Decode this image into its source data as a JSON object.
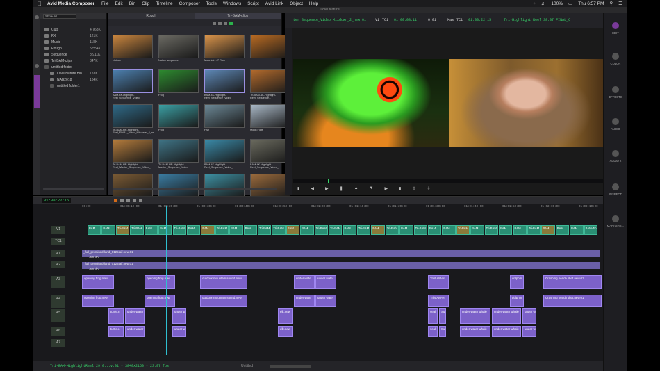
{
  "menubar": {
    "app": "Avid Media Composer",
    "items": [
      "File",
      "Edit",
      "Bin",
      "Clip",
      "Timeline",
      "Composer",
      "Tools",
      "Windows",
      "Script",
      "Avid Link",
      "Object",
      "Help"
    ],
    "battery": "100%",
    "clock": "Thu 6:57 PM"
  },
  "window_title": "Love Nature",
  "bin": {
    "filter": "Show All",
    "items": [
      {
        "name": "Cuts",
        "size": "4,768K"
      },
      {
        "name": "FX",
        "size": "121K"
      },
      {
        "name": "Music",
        "size": "118K"
      },
      {
        "name": "Rough",
        "size": "5,554K"
      },
      {
        "name": "Sequence",
        "size": "8,911K"
      },
      {
        "name": "Tri-BAM-clips",
        "size": "347K"
      },
      {
        "name": "untitled folder",
        "size": ""
      },
      {
        "name": "Love Nature Bin",
        "size": "178K"
      },
      {
        "name": "NAB2018",
        "size": "164K"
      },
      {
        "name": "untitled folder1",
        "size": ""
      }
    ]
  },
  "thumb_bin": {
    "tabs": [
      "Rough",
      "Tri-BAM-clips"
    ],
    "thumbs": [
      {
        "caption": "Nutrole",
        "color": "#c9853e"
      },
      {
        "caption": "Nature sequence",
        "color": "#6b6a63"
      },
      {
        "caption": "Mountain - 7 Rum",
        "color": "#d8934a"
      },
      {
        "caption": "",
        "color": "#b86a22"
      },
      {
        "caption": "BAM-4K-Highlight-Reel_Sequence_Video_",
        "color": "#4c7fae"
      },
      {
        "caption": "Frog",
        "color": "#2d8a2f"
      },
      {
        "caption": "BAM-4K-Highlight-Reel_Sequence_Video_",
        "color": "#5d87b5"
      },
      {
        "caption": "Tri-BAM-4K-Highlight-Reel_Sequence...",
        "color": "#b26a2c"
      },
      {
        "caption": "Tri-BAM-HR-Highlight-Reel_FINAL_Video_Mixdown_4_new.01",
        "color": "#2f6a88"
      },
      {
        "caption": "Frog",
        "color": "#3ba0a4"
      },
      {
        "caption": "Fish",
        "color": "#6c8896"
      },
      {
        "caption": "Moon Flats",
        "color": "#a9b8c6"
      },
      {
        "caption": "Tri-BAM-HR-Highlight-Reel_Master_Sequence_Video_",
        "color": "#b57c3c"
      },
      {
        "caption": "Tri-BAM-HR-Highlight-Master_Sequence_Video",
        "color": "#3f7486"
      },
      {
        "caption": "BAM-4K-Highlight-Reel_Sequence_Video_",
        "color": "#3a8aa8"
      },
      {
        "caption": "BAM-4K-Highlight-Reel_Sequence_Video_",
        "color": "#6a6a5e"
      },
      {
        "caption": "",
        "color": "#7a5a34"
      },
      {
        "caption": "BAM-HR-Highlight-Video",
        "color": "#3a7ba0"
      },
      {
        "caption": "Tri-BAM-Highlight-Reel_FINAL_Video_Mixdown",
        "color": "#3d8fa1"
      },
      {
        "caption": "BAM-HR-Highlight-Video",
        "color": "#9a6a3c"
      }
    ]
  },
  "monitor": {
    "source_name": "ter Sequence_Video Mixdown_2_new.01",
    "track": "V1",
    "tc1": "TC1",
    "tc_source": "01:00:03:11",
    "dur": "0:01",
    "mas": "Mas",
    "tc_mas": "01:00:22:15",
    "record_name": "Tri-Highlight Reel 38.07 FINAL_Copy.01"
  },
  "palette": [
    {
      "label": "EDIT"
    },
    {
      "label": "COLOR"
    },
    {
      "label": "EFFECTS"
    },
    {
      "label": "AUDIO"
    },
    {
      "label": "AUDIO 2"
    },
    {
      "label": "INSPECT"
    },
    {
      "label": "MARKERS..."
    }
  ],
  "timeline": {
    "timecode": "01:00:22:15",
    "ruler": [
      "00:00",
      "01:00:10:00",
      "01:00:20:00",
      "01:00:30:00",
      "01:00:40:00",
      "01:00:50:00",
      "01:01:00:00",
      "01:01:10:00",
      "01:01:20:00",
      "01:01:30:00",
      "01:01:40:00",
      "01:01:50:00",
      "01:02:00:00",
      "01:02:10:00"
    ],
    "tracks": [
      "V1",
      "TC1",
      "A1",
      "A2",
      "A3",
      "A4",
      "A5",
      "A6",
      "A7"
    ],
    "a1_clip": "_full_promised-land_0125.aif.new.01",
    "a1_level": "-6.5 db",
    "a2_clip": "_full_promised-land_0125.aif.new.01",
    "a2_level": "-6.5 db",
    "a3_clips": [
      "opening frog.new",
      "opening frog.new",
      "outdoor mountain sound.new",
      "under wate",
      "under wate",
      "Tri-BAM-H",
      "dolphin",
      "Crashing beach shot.new.01"
    ],
    "a5_clips": [
      "turtle.n",
      "under water",
      "under water",
      "elk.new",
      "seal",
      "Su",
      "under water whale",
      "under water whale",
      "under water whale"
    ],
    "v1_clips": [
      "BAM",
      "BAM",
      "Tri-BAM",
      "Tri-BAM",
      "BAM",
      "BAM",
      "Tri-BAM",
      "BAM",
      "BAM",
      "Tri-BAM",
      "BAM",
      "BAM",
      "Tri-BAM",
      "Tri-BAM",
      "BAM",
      "BAM",
      "Tri-BAM",
      "Tri-BAM",
      "BAM",
      "Tri-BAM",
      "BAM",
      "Tri-Fish",
      "BAM",
      "Tri-BAM",
      "BAM",
      "BAM",
      "Tri-BAM",
      "BAM",
      "Tri-BAM",
      "BAM",
      "BAM",
      "Tri-BAM",
      "BAM",
      "BAM",
      "BAM",
      "BAM-4K-Highlights-Master_Seque"
    ]
  },
  "status": {
    "text": "Tri-BAM-HighlightReel 29.0...v.01 - 3840x2160 - 23.97 fps",
    "scale": "Untitled"
  }
}
